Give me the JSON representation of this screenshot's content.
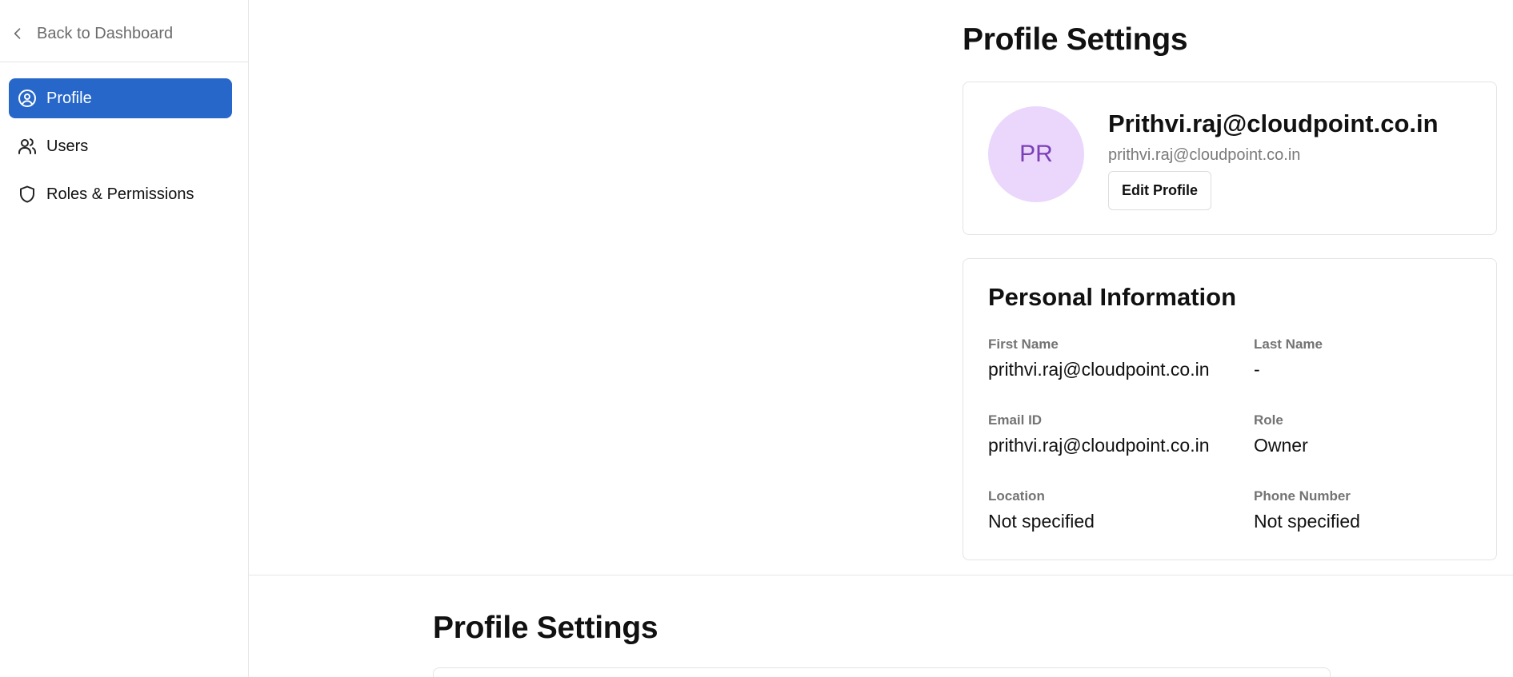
{
  "sidebar": {
    "back_label": "Back to Dashboard",
    "items": [
      {
        "label": "Profile",
        "icon": "user-circle-icon",
        "active": true
      },
      {
        "label": "Users",
        "icon": "users-icon",
        "active": false
      },
      {
        "label": "Roles & Permissions",
        "icon": "shield-icon",
        "active": false
      }
    ]
  },
  "main": {
    "title": "Profile Settings",
    "profile": {
      "initials": "PR",
      "name": "Prithvi.raj@cloudpoint.co.in",
      "email": "prithvi.raj@cloudpoint.co.in",
      "edit_label": "Edit Profile"
    },
    "personal_info": {
      "title": "Personal Information",
      "fields": [
        {
          "label": "First Name",
          "value": "prithvi.raj@cloudpoint.co.in"
        },
        {
          "label": "Last Name",
          "value": "-"
        },
        {
          "label": "Email ID",
          "value": "prithvi.raj@cloudpoint.co.in"
        },
        {
          "label": "Role",
          "value": "Owner"
        },
        {
          "label": "Location",
          "value": "Not specified"
        },
        {
          "label": "Phone Number",
          "value": "Not specified"
        }
      ]
    }
  },
  "lower": {
    "title": "Profile Settings"
  },
  "colors": {
    "accent": "#2667c9",
    "avatar_bg": "#ead7fb",
    "avatar_text": "#7b3fb7"
  }
}
